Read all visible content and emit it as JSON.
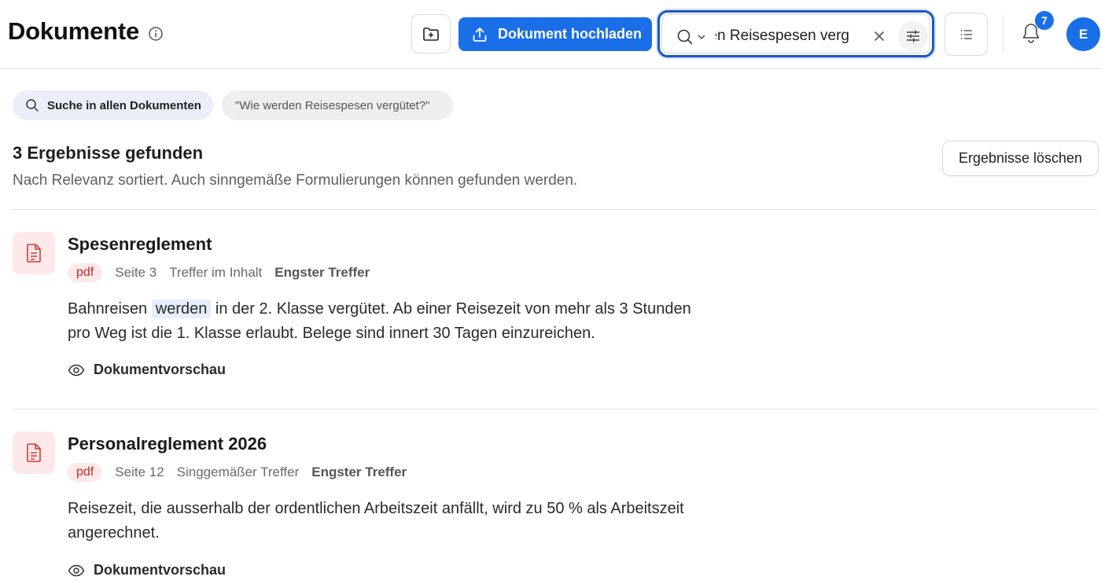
{
  "header": {
    "title": "Dokumente",
    "upload_label": "Dokument hochladen",
    "search_value": "Wie werden Reisespesen verg",
    "notification_count": "7",
    "avatar_initial": "E"
  },
  "filters": {
    "scope_label": "Suche in allen Dokumenten",
    "query_chip": "\"Wie werden Reisespesen vergütet?\""
  },
  "results": {
    "title": "3 Ergebnisse gefunden",
    "subtitle": "Nach Relevanz sortiert. Auch sinngemäße Formulierungen können gefunden werden.",
    "clear_label": "Ergebnisse löschen",
    "items": [
      {
        "title": "Spesenreglement",
        "type": "pdf",
        "page": "Seite 3",
        "match": "Treffer im Inhalt",
        "rank": "Engster Treffer",
        "snippet_before": "Bahnreisen ",
        "snippet_highlight": "werden",
        "snippet_after": " in der 2. Klasse vergütet. Ab einer Reisezeit von mehr als 3 Stunden pro Weg ist die 1. Klasse erlaubt. Belege sind innert 30 Tagen einzureichen.",
        "preview_label": "Dokumentvorschau"
      },
      {
        "title": "Personalreglement 2026",
        "type": "pdf",
        "page": "Seite 12",
        "match": "Singgemäßer Treffer",
        "rank": "Engster Treffer",
        "snippet": "Reisezeit, die ausserhalb der ordentlichen Arbeitszeit anfällt, wird zu 50 % als Arbeitszeit angerechnet.",
        "preview_label": "Dokumentvorschau"
      }
    ]
  },
  "colors": {
    "accent": "#1a6ee8",
    "pdf_red": "#c62828",
    "pdf_bg": "#fde9e9"
  }
}
